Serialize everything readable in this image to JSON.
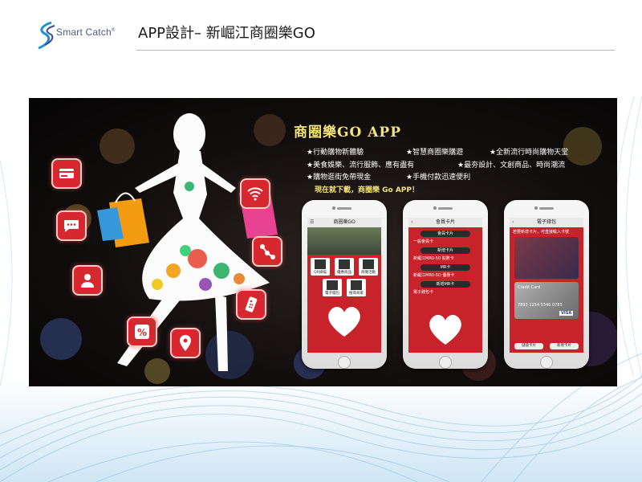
{
  "header": {
    "logo_text": "Smart Catch",
    "logo_mark": "®",
    "title": "APP設計– 新崛江商圈樂GO"
  },
  "banner": {
    "app_title": "商圈樂GO APP",
    "features": [
      "★行動購物新體驗",
      "★智慧商圈樂購遊",
      "★全新流行時尚購物天堂",
      "★美食娛樂、流行服飾、應有盡有",
      "★最夯設計、文創商品、時尚潮流",
      "★購物逛街免帶現金",
      "★手機付款迅速便利"
    ],
    "cta": "現在就下載，商圈樂 Go APP！",
    "icons": [
      "credit-card-icon",
      "chat-icon",
      "person-icon",
      "percent-icon",
      "location-pin-icon",
      "wifi-icon",
      "share-nodes-icon",
      "remote-control-icon"
    ],
    "accent": "#d7282f",
    "headline_color": "#f4e27a"
  },
  "phones": [
    {
      "title": "商圈樂GO",
      "buttons": [
        "QR掃描",
        "優惠商品",
        "商圈活動",
        "電子錢包",
        "搜尋商家"
      ]
    },
    {
      "title": "會員卡片",
      "items": [
        "會員卡片",
        "新增卡片",
        "MR卡",
        "新增MR卡",
        "電子錢包卡"
      ],
      "rows": [
        "一般會員卡",
        "新崛江MR0-50 點數卡",
        "新崛江MR0-5D 優惠卡"
      ]
    },
    {
      "title": "電子錢包",
      "note": "若要新增卡片，可直接輸入卡號",
      "card_label": "Credit Card",
      "card_number": "7893 1254 5346 0783",
      "brand": "VISA",
      "footer": [
        "儲值卡片",
        "新增卡片"
      ]
    }
  ]
}
